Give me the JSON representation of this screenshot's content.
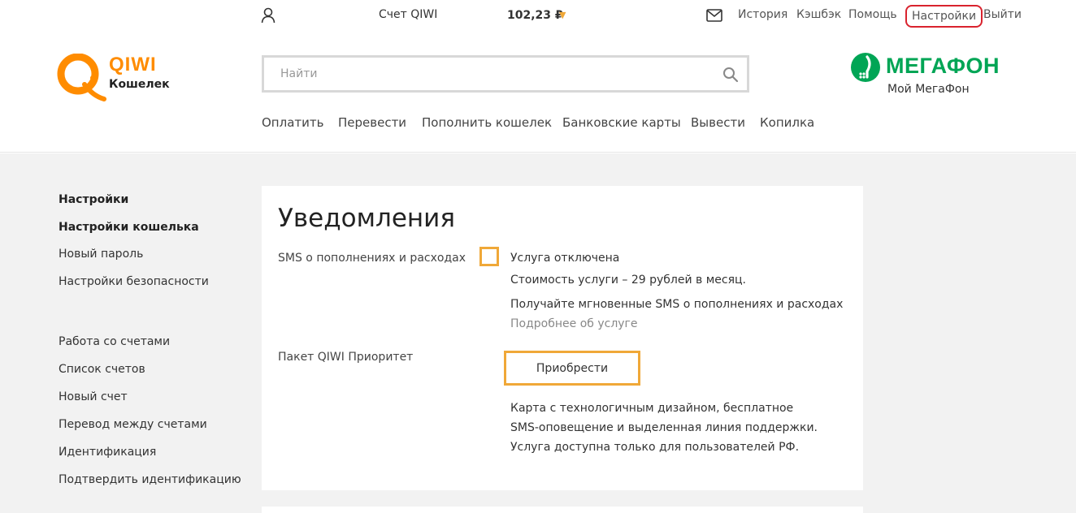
{
  "topbar": {
    "account_label": "Счет QIWI",
    "balance": "102,23 ₽",
    "links": {
      "history": "История",
      "cashback": "Кэшбэк",
      "help": "Помощь",
      "settings": "Настройки",
      "logout": "Выйти"
    }
  },
  "logo": {
    "line1": "QIWI",
    "line2": "Кошелек"
  },
  "search": {
    "placeholder": "Найти",
    "value": ""
  },
  "main_nav": [
    "Оплатить",
    "Перевести",
    "Пополнить кошелек",
    "Банковские карты",
    "Вывести",
    "Копилка"
  ],
  "partner": {
    "name": "МЕГАФОН",
    "subtitle": "Мой МегаФон"
  },
  "sidebar": {
    "group1": [
      "Настройки",
      "Настройки кошелька",
      "Новый пароль",
      "Настройки безопасности"
    ],
    "group2": [
      "Работа со счетами",
      "Список счетов",
      "Новый счет",
      "Перевод между счетами",
      "Идентификация",
      "Подтвердить идентификацию"
    ]
  },
  "notifications": {
    "title": "Уведомления",
    "sms_label": "SMS о пополнениях и расходах",
    "sms_status": "Услуга отключена",
    "sms_cost": "Стоимость услуги – 29 рублей в месяц.",
    "sms_info": "Получайте мгновенные SMS о пополнениях и расходах",
    "sms_more": "Подробнее об услуге",
    "priority_label": "Пакет QIWI Приоритет",
    "buy_button": "Приобрести",
    "priority_desc": "Карта с технологичным дизайном, бесплатное SMS-оповещение и выделенная линия поддержки. Услуга доступна только для пользователей РФ."
  },
  "colors": {
    "qiwi_orange": "#ff8c00",
    "accent_border": "#f0a838",
    "megafon_green": "#00a555",
    "highlight_red": "#d9232e"
  }
}
